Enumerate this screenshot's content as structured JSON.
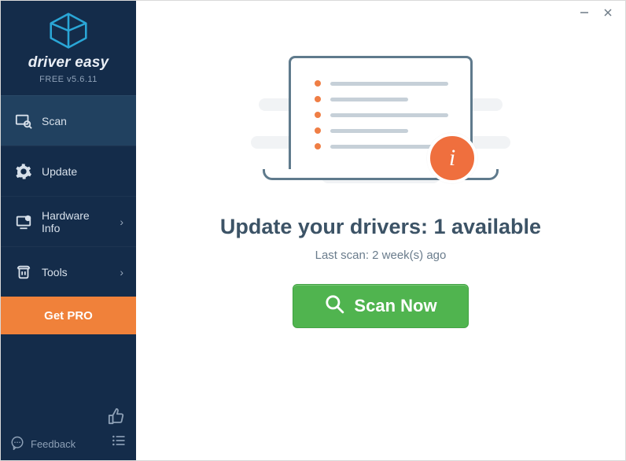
{
  "brand": {
    "name": "driver easy",
    "subtitle": "FREE v5.6.11"
  },
  "sidebar": {
    "items": [
      {
        "label": "Scan",
        "chevron": false,
        "active": true
      },
      {
        "label": "Update",
        "chevron": false,
        "active": false
      },
      {
        "label": "Hardware Info",
        "chevron": true,
        "active": false
      },
      {
        "label": "Tools",
        "chevron": true,
        "active": false
      }
    ],
    "get_pro_label": "Get PRO",
    "feedback_label": "Feedback"
  },
  "main": {
    "headline": "Update your drivers: 1 available",
    "last_scan": "Last scan: 2 week(s) ago",
    "scan_button": "Scan Now",
    "info_badge": "i"
  },
  "colors": {
    "sidebar_bg": "#142c4a",
    "sidebar_active": "#214160",
    "accent_orange": "#f0813a",
    "badge_orange": "#ef6f3e",
    "scan_green": "#50b44f",
    "headline": "#3c5366"
  }
}
